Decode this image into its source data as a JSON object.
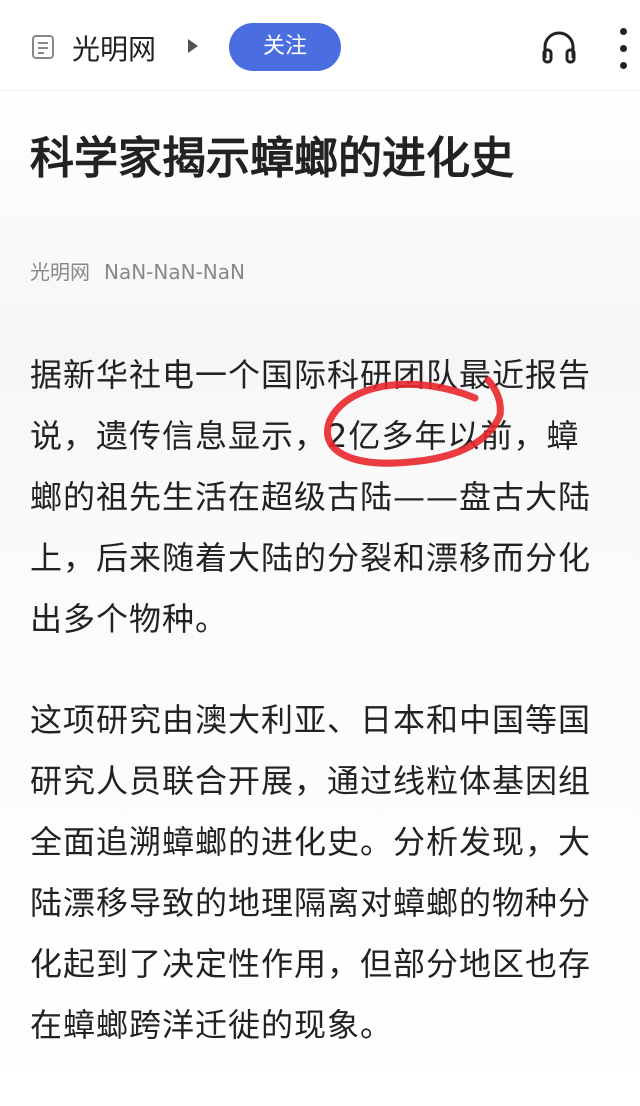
{
  "header": {
    "source": "光明网",
    "follow_label": "关注",
    "icons": [
      "document-icon",
      "play-arrow-icon",
      "headphones-icon",
      "more-vertical-icon"
    ],
    "accent": "#4a6ee0"
  },
  "article": {
    "title": "科学家揭示蟑螂的进化史",
    "meta_source": "光明网",
    "meta_date": "NaN-NaN-NaN",
    "paragraphs": [
      [
        "据新华社电一个国际科研团队最近报告",
        "说，遗传信息显示，2亿多年以前，蟑",
        "螂的祖先生活在超级古陆——盘古大陆",
        "上，后来随着大陆的分裂和漂移而分化",
        "出多个物种。"
      ],
      [
        "这项研究由澳大利亚、日本和中国等国",
        "研究人员联合开展，通过线粒体基因组",
        "全面追溯蟑螂的进化史。分析发现，大",
        "陆漂移导致的地理隔离对蟑螂的物种分",
        "化起到了决定性作用，但部分地区也存",
        "在蟑螂跨洋迁徙的现象。"
      ]
    ],
    "annotation_color": "#e8262b"
  }
}
